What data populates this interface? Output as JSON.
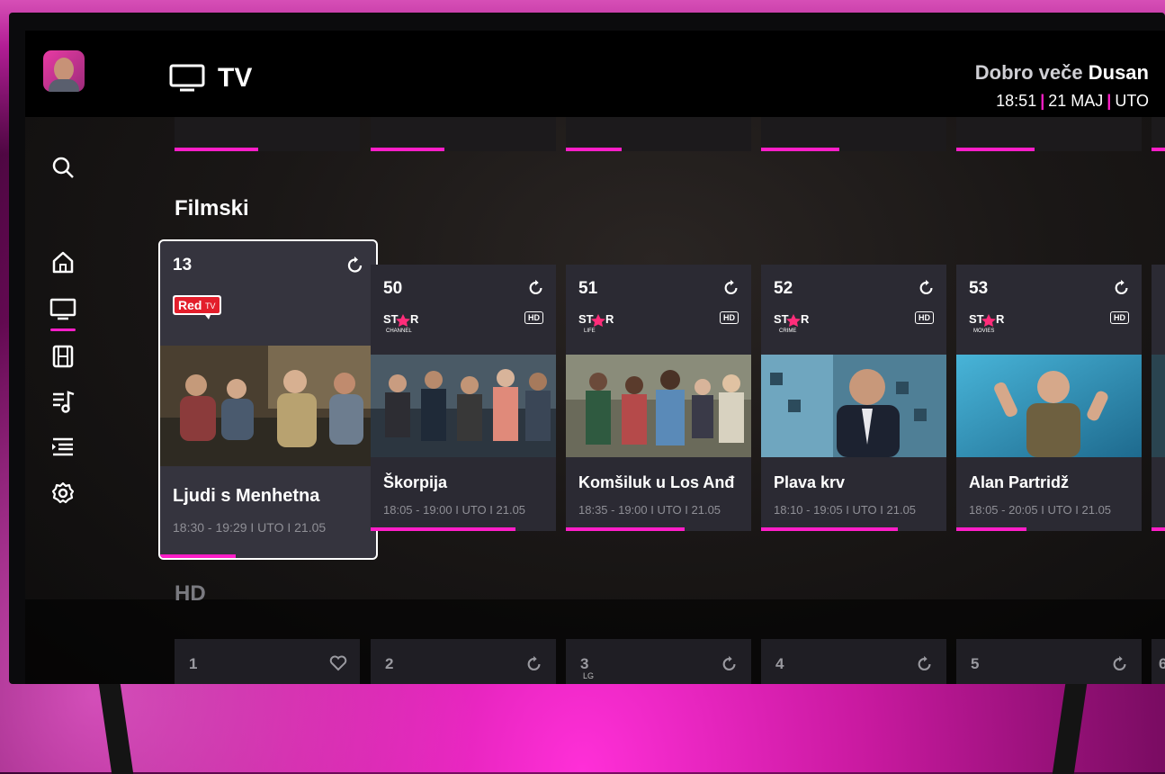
{
  "header": {
    "title": "TV",
    "greeting_prefix": "Dobro veče",
    "user_name": "Dusan",
    "time": "18:51",
    "date": "21 MAJ",
    "day": "UTO"
  },
  "sidebar": {
    "items": [
      {
        "icon": "search-icon"
      },
      {
        "icon": "home-icon"
      },
      {
        "icon": "tv-icon",
        "active": true
      },
      {
        "icon": "film-icon"
      },
      {
        "icon": "music-playlist-icon"
      },
      {
        "icon": "list-icon"
      },
      {
        "icon": "gear-icon"
      }
    ]
  },
  "sections": {
    "movies_title": "Filmski",
    "hd_title": "HD"
  },
  "channels": [
    {
      "number": "13",
      "logo": "Red TV",
      "hd": false,
      "title": "Ljudi s Menhetna",
      "time": "18:30 - 19:29 I UTO I 21.05",
      "progress": 0.35
    },
    {
      "number": "50",
      "logo": "STAR CHANNEL",
      "logo_sub": "CHANNEL",
      "hd": true,
      "title": "Škorpija",
      "time": "18:05 - 19:00 I UTO I 21.05",
      "progress": 0.78
    },
    {
      "number": "51",
      "logo": "STAR LIFE",
      "logo_sub": "LIFE",
      "hd": true,
      "title": "Komšiluk u Los Anđ",
      "time": "18:35 - 19:00 I UTO I 21.05",
      "progress": 0.64
    },
    {
      "number": "52",
      "logo": "STAR CRIME",
      "logo_sub": "CRIME",
      "hd": true,
      "title": "Plava krv",
      "time": "18:10 - 19:05 I UTO I 21.05",
      "progress": 0.74
    },
    {
      "number": "53",
      "logo": "STAR MOVIES",
      "logo_sub": "MOVIES",
      "hd": true,
      "title": "Alan Partridž",
      "time": "18:05 - 20:05 I UTO I 21.05",
      "progress": 0.38
    }
  ],
  "hd_channels": [
    "1",
    "2",
    "3",
    "4",
    "5",
    "6"
  ],
  "colors": {
    "accent": "#ff1ec8",
    "background": "#000000",
    "card": "#2b2a33"
  }
}
